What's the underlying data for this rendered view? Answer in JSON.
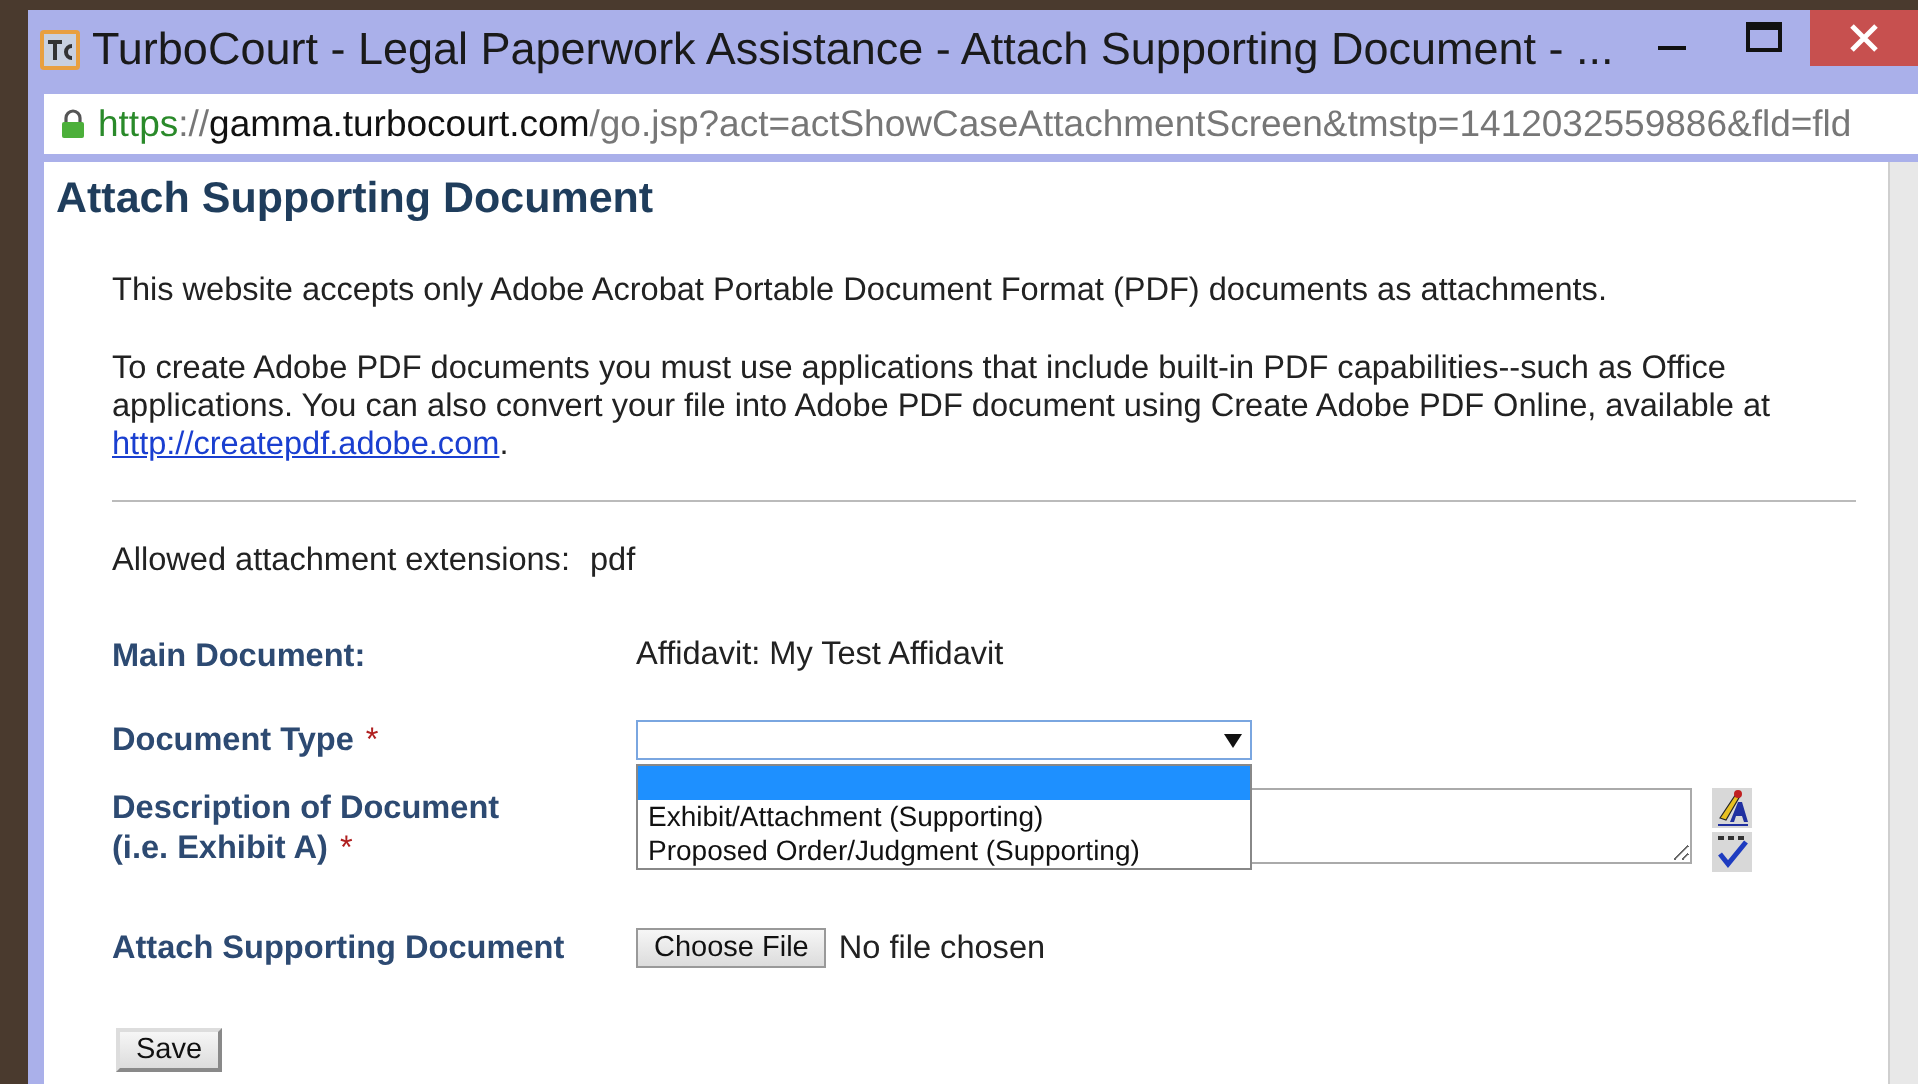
{
  "window": {
    "title": "TurboCourt - Legal Paperwork Assistance - Attach Supporting Document - ..."
  },
  "address_bar": {
    "scheme": "https",
    "separator": "://",
    "host": "gamma.turbocourt.com",
    "path": "/go.jsp?act=actShowCaseAttachmentScreen&tmstp=1412032559886&fld=fld"
  },
  "page": {
    "heading": "Attach Supporting Document",
    "intro": "This website accepts only Adobe Acrobat Portable Document Format (PDF) documents as attachments.",
    "note": {
      "text": "To create Adobe PDF documents you must use applications that include built-in PDF capabilities--such as Office applications. You can also convert your file into Adobe PDF document using Create Adobe PDF Online, available at ",
      "link": "http://createpdf.adobe.com",
      "end": "."
    },
    "extensions": {
      "label": "Allowed attachment extensions:",
      "value": "pdf"
    },
    "fields": [
      {
        "kind": "text",
        "label": "Main Document:",
        "value": "Affidavit: My Test Affidavit"
      },
      {
        "kind": "select",
        "label": "Document Type",
        "required_mark": "*",
        "expanded": true,
        "options": [
          {
            "selected": true
          },
          {
            "label": "Exhibit/Attachment (Supporting)",
            "selected": false
          },
          {
            "label": "Proposed Order/Judgment (Supporting)",
            "selected": false
          }
        ]
      },
      {
        "kind": "textarea",
        "label": "Description of Document",
        "sublabel": "(i.e. Exhibit A)",
        "required_mark": "*"
      },
      {
        "kind": "file",
        "label": "Attach Supporting Document",
        "button": "Choose File",
        "status": "No file chosen"
      }
    ],
    "save_button": "Save"
  }
}
